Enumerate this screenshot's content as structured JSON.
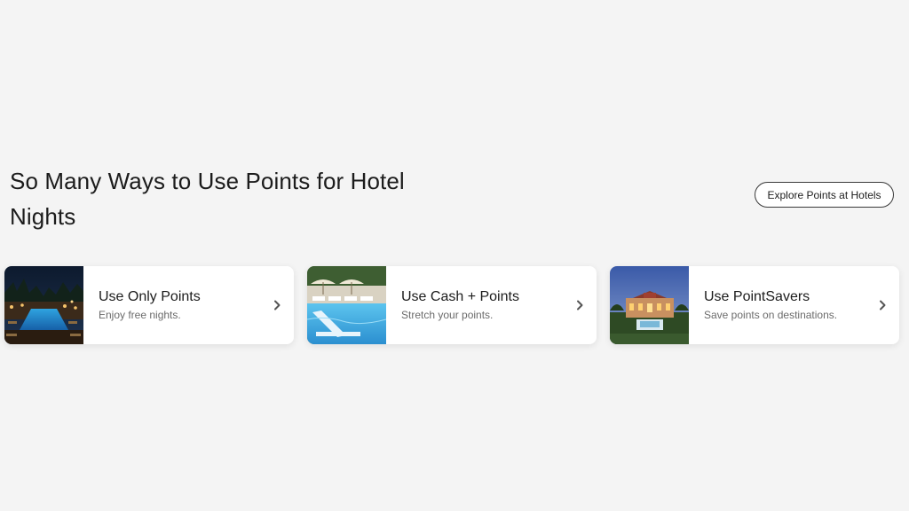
{
  "section": {
    "title": "So Many Ways to Use Points for Hotel Nights",
    "explore_label": "Explore Points at Hotels"
  },
  "cards": [
    {
      "title": "Use Only Points",
      "subtitle": "Enjoy free nights.",
      "image": "night-resort-pool-photo",
      "icon": "chevron-right-icon"
    },
    {
      "title": "Use Cash + Points",
      "subtitle": "Stretch your points.",
      "image": "poolside-loungers-photo",
      "icon": "chevron-right-icon"
    },
    {
      "title": "Use PointSavers",
      "subtitle": "Save points on destinations.",
      "image": "palace-hotel-dusk-photo",
      "icon": "chevron-right-icon"
    }
  ],
  "colors": {
    "background": "#f4f4f4",
    "card": "#ffffff",
    "text": "#1c1c1c",
    "subtext": "#6b6b6b",
    "button_border": "#3a3a3a"
  }
}
